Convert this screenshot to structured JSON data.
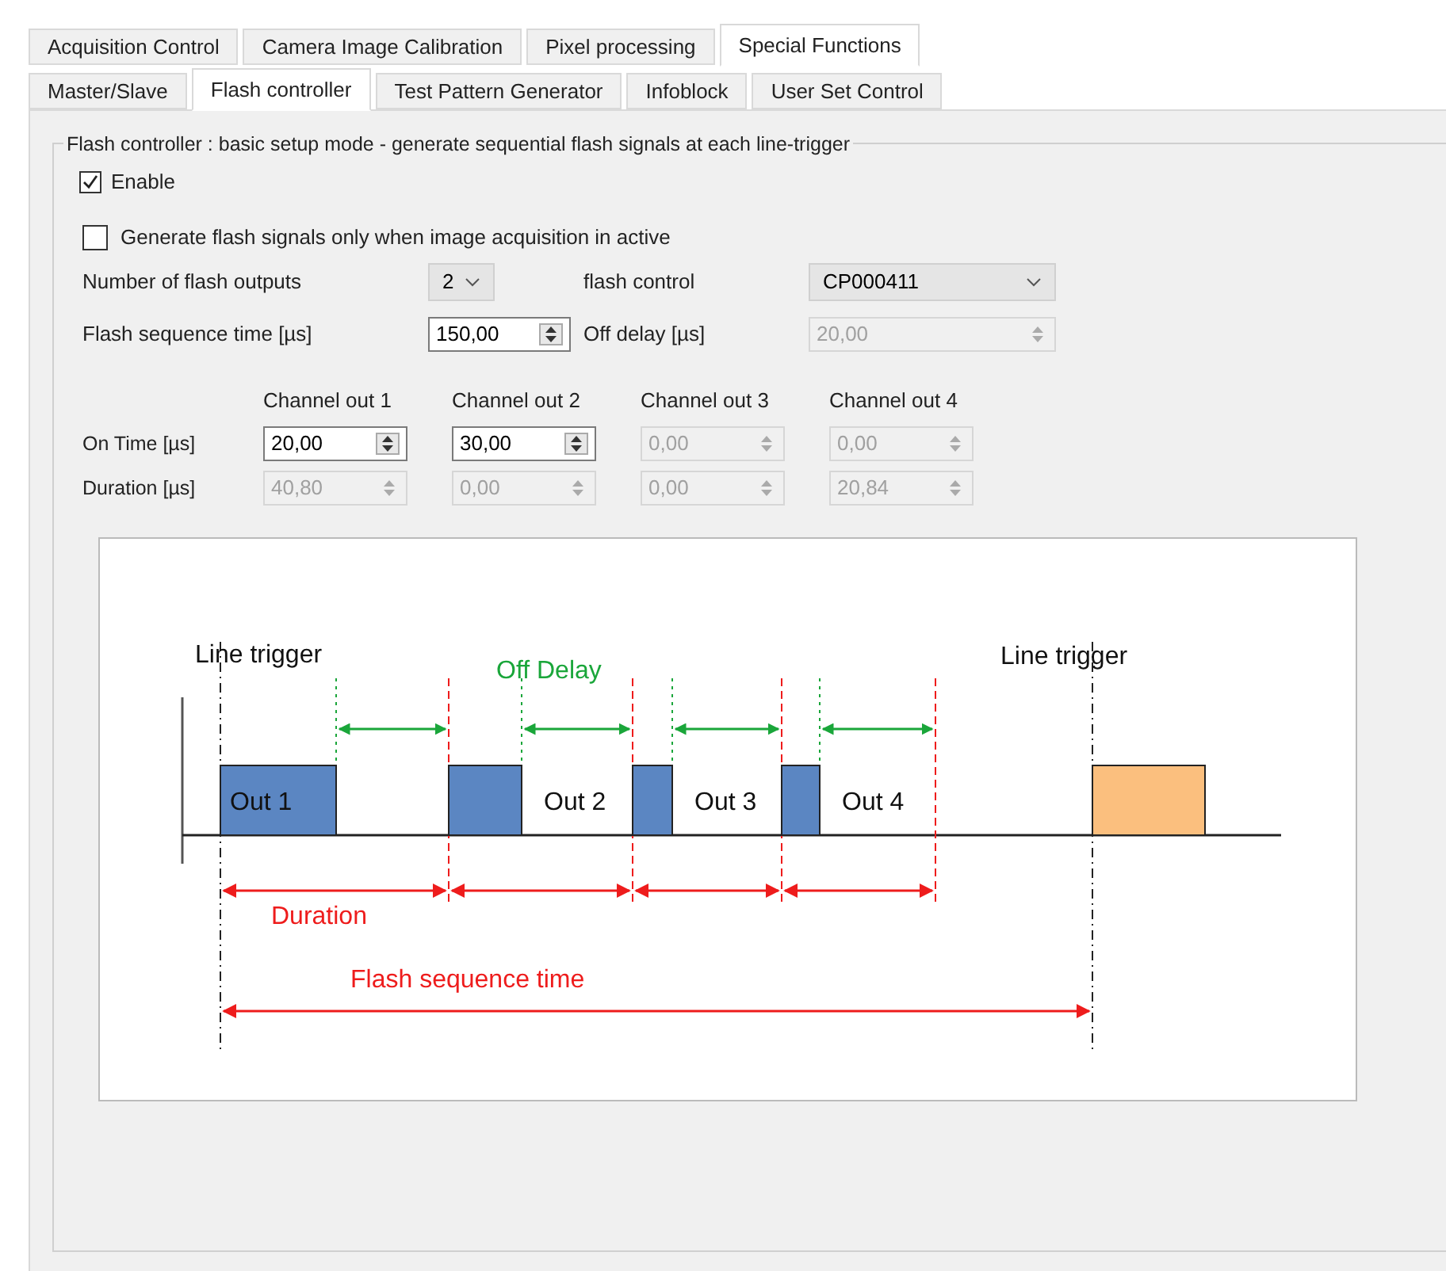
{
  "tabs": [
    {
      "label": "Acquisition Control",
      "selected": false
    },
    {
      "label": "Camera Image Calibration",
      "selected": false
    },
    {
      "label": "Pixel processing",
      "selected": false
    },
    {
      "label": "Special Functions",
      "selected": true
    }
  ],
  "subtabs": [
    {
      "label": "Master/Slave",
      "selected": false
    },
    {
      "label": "Flash controller",
      "selected": true
    },
    {
      "label": "Test Pattern Generator",
      "selected": false
    },
    {
      "label": "Infoblock",
      "selected": false
    },
    {
      "label": "User Set Control",
      "selected": false
    }
  ],
  "group": {
    "title": "Flash controller : basic setup mode - generate sequential flash signals at each line-trigger",
    "enable": {
      "label": "Enable",
      "checked": true
    },
    "only_when_active": {
      "label": "Generate flash signals only when image acquisition in active",
      "checked": false
    },
    "rows": [
      [
        {
          "kind": "label",
          "text": "Number of flash outputs"
        },
        {
          "kind": "combo",
          "value": "2",
          "disabled": false
        },
        {
          "kind": "label",
          "text": "flash control"
        },
        {
          "kind": "combo",
          "value": "CP000411",
          "disabled": false
        }
      ],
      [
        {
          "kind": "label",
          "text": "Flash sequence time [µs]"
        },
        {
          "kind": "spin",
          "value": "150,00",
          "disabled": false
        },
        {
          "kind": "label",
          "text": "Off delay [µs]"
        },
        {
          "kind": "spin",
          "value": "20,00",
          "disabled": true
        }
      ]
    ],
    "channel_headers": [
      "Channel out 1",
      "Channel out 2",
      "Channel out 3",
      "Channel out 4"
    ],
    "channel_rows": [
      {
        "label": "On Time [µs]",
        "cells": [
          {
            "value": "20,00",
            "disabled": false
          },
          {
            "value": "30,00",
            "disabled": false
          },
          {
            "value": "0,00",
            "disabled": true
          },
          {
            "value": "0,00",
            "disabled": true
          }
        ]
      },
      {
        "label": "Duration [µs]",
        "cells": [
          {
            "value": "40,80",
            "disabled": true
          },
          {
            "value": "0,00",
            "disabled": true
          },
          {
            "value": "0,00",
            "disabled": true
          },
          {
            "value": "20,84",
            "disabled": true
          }
        ]
      }
    ],
    "diagram": {
      "line_trigger_left": "Line trigger",
      "line_trigger_right": "Line trigger",
      "off_delay": "Off Delay",
      "outputs": [
        "Out 1",
        "Out 2",
        "Out 3",
        "Out 4"
      ],
      "duration": "Duration",
      "flash_sequence_time": "Flash sequence time"
    }
  }
}
